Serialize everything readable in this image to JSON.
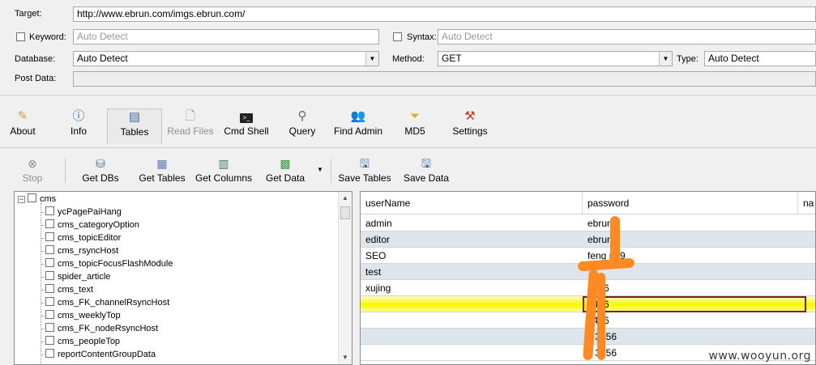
{
  "form": {
    "target_label": "Target:",
    "target_value": "http://www.ebrun.com/imgs.ebrun.com/",
    "keyword_label": "Keyword:",
    "keyword_placeholder": "Auto Detect",
    "syntax_label": "Syntax:",
    "syntax_placeholder": "Auto Detect",
    "database_label": "Database:",
    "database_value": "Auto Detect",
    "method_label": "Method:",
    "method_value": "GET",
    "type_label": "Type:",
    "type_value": "Auto Detect",
    "postdata_label": "Post Data:"
  },
  "main_toolbar": [
    {
      "label": "About",
      "icon": "pencil-icon"
    },
    {
      "label": "Info",
      "icon": "info-icon"
    },
    {
      "label": "Tables",
      "icon": "tables-icon",
      "active": true
    },
    {
      "label": "Read Files",
      "icon": "file-icon",
      "disabled": true
    },
    {
      "label": "Cmd Shell",
      "icon": "terminal-icon"
    },
    {
      "label": "Query",
      "icon": "query-icon"
    },
    {
      "label": "Find Admin",
      "icon": "users-icon"
    },
    {
      "label": "MD5",
      "icon": "md5-icon"
    },
    {
      "label": "Settings",
      "icon": "tools-icon"
    }
  ],
  "action_toolbar": [
    {
      "label": "Stop",
      "icon": "stop-icon",
      "disabled": true
    },
    {
      "label": "Get DBs",
      "icon": "database-icon"
    },
    {
      "label": "Get Tables",
      "icon": "table-grid-icon"
    },
    {
      "label": "Get Columns",
      "icon": "columns-icon"
    },
    {
      "label": "Get Data",
      "icon": "data-icon"
    },
    {
      "label": "Save Tables",
      "icon": "save-icon"
    },
    {
      "label": "Save Data",
      "icon": "save-icon"
    }
  ],
  "tree": {
    "root": "cms",
    "items": [
      "ycPagePaiHang",
      "cms_categoryOption",
      "cms_topicEditor",
      "cms_rsyncHost",
      "cms_topicFocusFlashModule",
      "spider_article",
      "cms_text",
      "cms_FK_channelRsyncHost",
      "cms_weeklyTop",
      "cms_FK_nodeRsyncHost",
      "cms_peopleTop",
      "reportContentGroupData"
    ]
  },
  "grid": {
    "columns": [
      "userName",
      "password",
      "na"
    ],
    "rows": [
      [
        "admin",
        "ebrun"
      ],
      [
        "editor",
        "ebrun"
      ],
      [
        "SEO",
        "feng    n09"
      ],
      [
        "test",
        ""
      ],
      [
        "xujing",
        "  3456"
      ],
      [
        "",
        "  3456"
      ],
      [
        "",
        "  3456"
      ],
      [
        "",
        "x   3456"
      ],
      [
        "",
        "x   3456"
      ]
    ]
  },
  "watermark": "www.wooyun.org",
  "colors": {
    "redaction": "#ff8a24",
    "selected_row": "#f8f800",
    "alt_row": "#dce6ec"
  }
}
